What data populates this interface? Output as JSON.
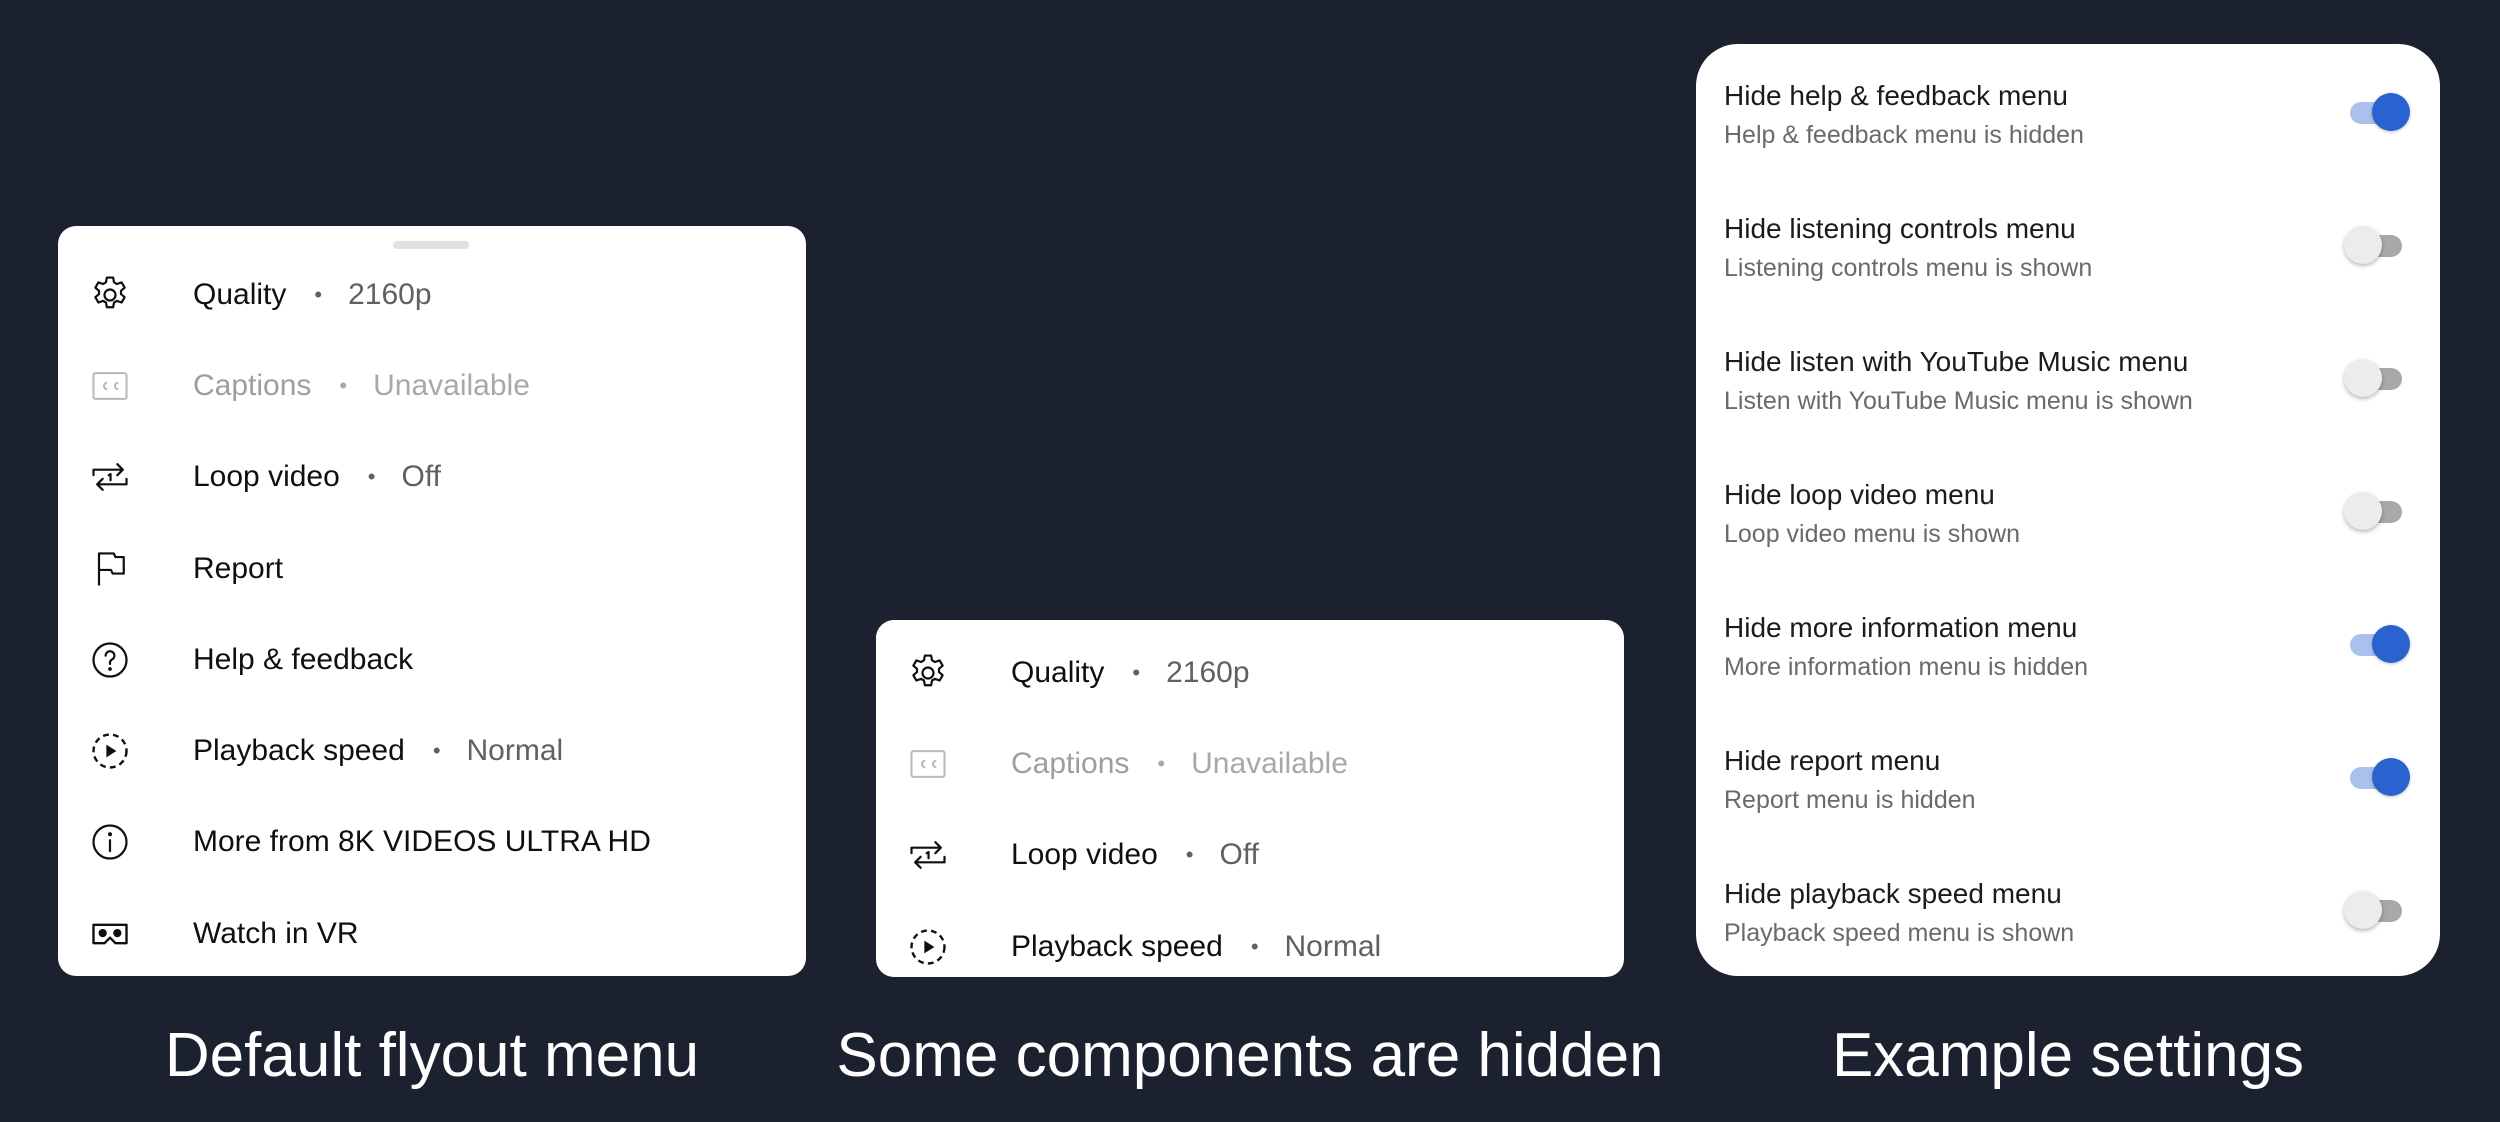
{
  "colors": {
    "background": "#1c2130",
    "panel": "#ffffff",
    "switch_on": "#2a62d0",
    "switch_on_track": "#a9c1ec",
    "switch_off_track": "#a8a8a8"
  },
  "default_menu": {
    "caption": "Default flyout menu",
    "items": [
      {
        "icon": "gear-icon",
        "label": "Quality",
        "value": "2160p"
      },
      {
        "icon": "closed-captions-icon",
        "label": "Captions",
        "value": "Unavailable",
        "disabled": true
      },
      {
        "icon": "loop-icon",
        "label": "Loop video",
        "value": "Off"
      },
      {
        "icon": "flag-icon",
        "label": "Report"
      },
      {
        "icon": "help-circle-icon",
        "label": "Help & feedback"
      },
      {
        "icon": "playback-speed-icon",
        "label": "Playback speed",
        "value": "Normal"
      },
      {
        "icon": "info-circle-icon",
        "label": "More from 8K VIDEOS ULTRA HD"
      },
      {
        "icon": "vr-headset-icon",
        "label": "Watch in VR"
      }
    ]
  },
  "hidden_menu": {
    "caption": "Some components are hidden",
    "items": [
      {
        "icon": "gear-icon",
        "label": "Quality",
        "value": "2160p"
      },
      {
        "icon": "closed-captions-icon",
        "label": "Captions",
        "value": "Unavailable",
        "disabled": true
      },
      {
        "icon": "loop-icon",
        "label": "Loop video",
        "value": "Off"
      },
      {
        "icon": "playback-speed-icon",
        "label": "Playback speed",
        "value": "Normal"
      }
    ]
  },
  "settings": {
    "caption": "Example settings",
    "items": [
      {
        "title": "Hide help & feedback menu",
        "summary": "Help & feedback menu is hidden",
        "enabled": true
      },
      {
        "title": "Hide listening controls menu",
        "summary": "Listening controls menu is shown",
        "enabled": false
      },
      {
        "title": "Hide listen with YouTube Music menu",
        "summary": "Listen with YouTube Music menu is shown",
        "enabled": false
      },
      {
        "title": "Hide loop video menu",
        "summary": "Loop video menu is shown",
        "enabled": false
      },
      {
        "title": "Hide more information menu",
        "summary": "More information menu is hidden",
        "enabled": true
      },
      {
        "title": "Hide report menu",
        "summary": "Report menu is hidden",
        "enabled": true
      },
      {
        "title": "Hide playback speed menu",
        "summary": "Playback speed menu is shown",
        "enabled": false
      }
    ]
  }
}
